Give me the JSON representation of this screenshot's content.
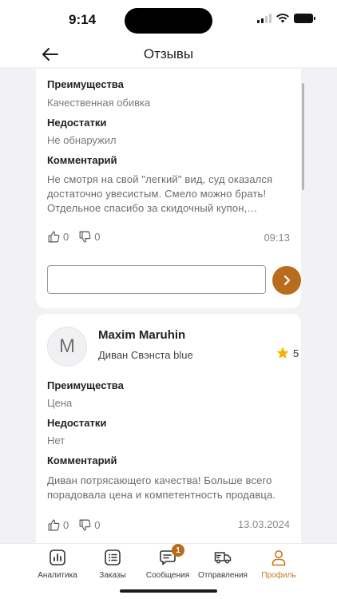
{
  "status": {
    "time": "9:14"
  },
  "header": {
    "title": "Отзывы"
  },
  "reviews": [
    {
      "pros_label": "Преимущества",
      "pros": "Качественная обивка",
      "cons_label": "Недостатки",
      "cons": "Не обнаружил",
      "comment_label": "Комментарий",
      "comment": "Не смотря на свой \"легкий\" вид, суд оказался достаточно увесистым. Смело можно брать! Отдельное спасибо за скидочный купон, закажу ещё",
      "likes": "0",
      "dislikes": "0",
      "time": "09:13",
      "reply_value": "",
      "reply_placeholder": ""
    },
    {
      "avatar_letter": "M",
      "author": "Maxim Maruhin",
      "product": "Диван Свэнста blue",
      "rating": "5",
      "pros_label": "Преимущества",
      "pros": "Цена",
      "cons_label": "Недостатки",
      "cons": "Нет",
      "comment_label": "Комментарий",
      "comment": "Диван потрясающего качества! Больше всего порадовала цена и компетентность продавца.",
      "likes": "0",
      "dislikes": "0",
      "date": "13.03.2024"
    }
  ],
  "tabbar": {
    "items": [
      {
        "label": "Аналитика",
        "icon": "analytics-icon"
      },
      {
        "label": "Заказы",
        "icon": "orders-icon"
      },
      {
        "label": "Сообщения",
        "icon": "messages-icon",
        "badge": "1"
      },
      {
        "label": "Отправления",
        "icon": "truck-icon"
      },
      {
        "label": "Профиль",
        "icon": "profile-icon",
        "active": true
      }
    ]
  },
  "colors": {
    "accent": "#b86c1c",
    "active_tab": "#c27a23",
    "star": "#f5b400"
  }
}
